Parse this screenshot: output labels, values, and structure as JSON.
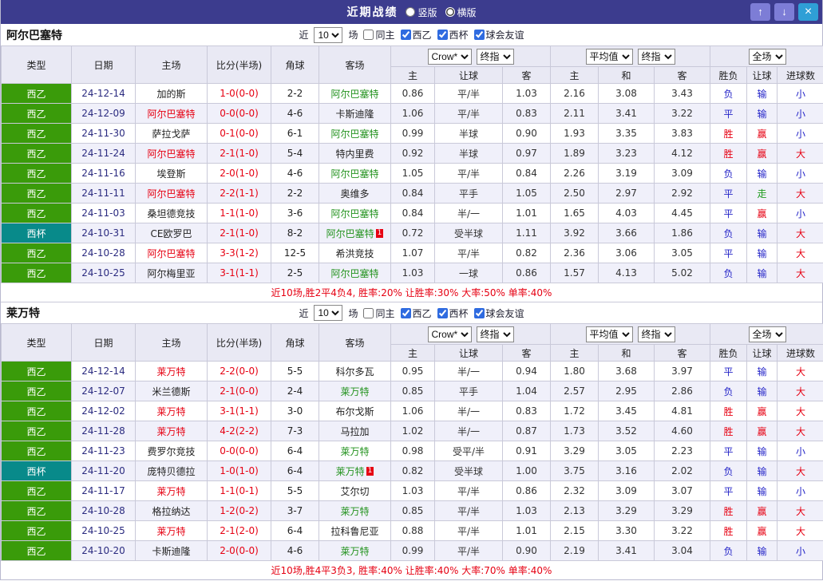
{
  "topbar": {
    "title": "近期战绩",
    "layout_options": [
      {
        "label": "竖版",
        "selected": false
      },
      {
        "label": "横版",
        "selected": true
      }
    ],
    "up_button": "↑",
    "down_button": "↓",
    "close_button": "×"
  },
  "filter": {
    "prefix": "近",
    "count": "10",
    "suffix": "场",
    "checkboxes": [
      {
        "key": "same-home",
        "label": "同主",
        "checked": false
      },
      {
        "key": "liga2",
        "label": "西乙",
        "checked": true
      },
      {
        "key": "cup",
        "label": "西杯",
        "checked": true
      },
      {
        "key": "friendly",
        "label": "球会友谊",
        "checked": true
      }
    ]
  },
  "table_head": {
    "left": [
      "类型",
      "日期",
      "主场",
      "比分(半场)",
      "角球",
      "客场"
    ],
    "group1": {
      "selects": [
        "Crow*",
        "终指"
      ],
      "cols": [
        "主",
        "让球",
        "客"
      ]
    },
    "group2": {
      "selects": [
        "平均值",
        "终指"
      ],
      "cols": [
        "主",
        "和",
        "客"
      ]
    },
    "group3": {
      "selects": [
        "全场"
      ],
      "cols": [
        "胜负",
        "让球",
        "进球数"
      ]
    }
  },
  "palette": {
    "topbar_bg": "#3c3c8e",
    "liga_green": "#3a9b0a",
    "cup_teal": "#088a8a",
    "win_red": "#e60012",
    "lose_blue": "#2424c8",
    "push_green": "#1e9b1e",
    "focus_away_green": "#22921d",
    "date_navy": "#2b2b80",
    "alt_row_bg": "#f0f0fa",
    "header_bg": "#e9e9f4"
  },
  "sections": [
    {
      "team": "阿尔巴塞特",
      "rows": [
        {
          "type": "西乙",
          "type_cls": "liga",
          "date": "24-12-14",
          "home": "加的斯",
          "home_cls": "plain",
          "score": "1-0(0-0)",
          "corner": "2-2",
          "away": "阿尔巴塞特",
          "away_cls": "focus-away",
          "odds": [
            "0.86",
            "平/半",
            "1.03",
            "2.16",
            "3.08",
            "3.43"
          ],
          "result": "负",
          "result_cls": "blue",
          "let": "输",
          "let_cls": "blue",
          "goal": "小",
          "goal_cls": "blue"
        },
        {
          "type": "西乙",
          "type_cls": "liga",
          "date": "24-12-09",
          "home": "阿尔巴塞特",
          "home_cls": "focus-home",
          "score": "0-0(0-0)",
          "corner": "4-6",
          "away": "卡斯迪隆",
          "away_cls": "plain",
          "odds": [
            "1.06",
            "平/半",
            "0.83",
            "2.11",
            "3.41",
            "3.22"
          ],
          "result": "平",
          "result_cls": "blue",
          "let": "输",
          "let_cls": "blue",
          "goal": "小",
          "goal_cls": "blue"
        },
        {
          "type": "西乙",
          "type_cls": "liga",
          "date": "24-11-30",
          "home": "萨拉戈萨",
          "home_cls": "plain",
          "score": "0-1(0-0)",
          "corner": "6-1",
          "away": "阿尔巴塞特",
          "away_cls": "focus-away",
          "odds": [
            "0.99",
            "半球",
            "0.90",
            "1.93",
            "3.35",
            "3.83"
          ],
          "result": "胜",
          "result_cls": "red",
          "let": "赢",
          "let_cls": "red",
          "goal": "小",
          "goal_cls": "blue"
        },
        {
          "type": "西乙",
          "type_cls": "liga",
          "date": "24-11-24",
          "home": "阿尔巴塞特",
          "home_cls": "focus-home",
          "score": "2-1(1-0)",
          "corner": "5-4",
          "away": "特内里费",
          "away_cls": "plain",
          "odds": [
            "0.92",
            "半球",
            "0.97",
            "1.89",
            "3.23",
            "4.12"
          ],
          "result": "胜",
          "result_cls": "red",
          "let": "赢",
          "let_cls": "red",
          "goal": "大",
          "goal_cls": "red"
        },
        {
          "type": "西乙",
          "type_cls": "liga",
          "date": "24-11-16",
          "home": "埃登斯",
          "home_cls": "plain",
          "score": "2-0(1-0)",
          "corner": "4-6",
          "away": "阿尔巴塞特",
          "away_cls": "focus-away",
          "odds": [
            "1.05",
            "平/半",
            "0.84",
            "2.26",
            "3.19",
            "3.09"
          ],
          "result": "负",
          "result_cls": "blue",
          "let": "输",
          "let_cls": "blue",
          "goal": "小",
          "goal_cls": "blue"
        },
        {
          "type": "西乙",
          "type_cls": "liga",
          "date": "24-11-11",
          "home": "阿尔巴塞特",
          "home_cls": "focus-home",
          "score": "2-2(1-1)",
          "corner": "2-2",
          "away": "奥维多",
          "away_cls": "plain",
          "odds": [
            "0.84",
            "平手",
            "1.05",
            "2.50",
            "2.97",
            "2.92"
          ],
          "result": "平",
          "result_cls": "blue",
          "let": "走",
          "let_cls": "green",
          "goal": "大",
          "goal_cls": "red"
        },
        {
          "type": "西乙",
          "type_cls": "liga",
          "date": "24-11-03",
          "home": "桑坦德竞技",
          "home_cls": "plain",
          "score": "1-1(1-0)",
          "corner": "3-6",
          "away": "阿尔巴塞特",
          "away_cls": "focus-away",
          "odds": [
            "0.84",
            "半/一",
            "1.01",
            "1.65",
            "4.03",
            "4.45"
          ],
          "result": "平",
          "result_cls": "blue",
          "let": "赢",
          "let_cls": "red",
          "goal": "小",
          "goal_cls": "blue"
        },
        {
          "type": "西杯",
          "type_cls": "cup",
          "date": "24-10-31",
          "home": "CE欧罗巴",
          "home_cls": "plain",
          "score": "2-1(1-0)",
          "corner": "8-2",
          "away": "阿尔巴塞特",
          "away_cls": "focus-away",
          "away_badge": "1",
          "odds": [
            "0.72",
            "受半球",
            "1.11",
            "3.92",
            "3.66",
            "1.86"
          ],
          "result": "负",
          "result_cls": "blue",
          "let": "输",
          "let_cls": "blue",
          "goal": "大",
          "goal_cls": "red"
        },
        {
          "type": "西乙",
          "type_cls": "liga",
          "date": "24-10-28",
          "home": "阿尔巴塞特",
          "home_cls": "focus-home",
          "score": "3-3(1-2)",
          "corner": "12-5",
          "away": "希洪竞技",
          "away_cls": "plain",
          "odds": [
            "1.07",
            "平/半",
            "0.82",
            "2.36",
            "3.06",
            "3.05"
          ],
          "result": "平",
          "result_cls": "blue",
          "let": "输",
          "let_cls": "blue",
          "goal": "大",
          "goal_cls": "red"
        },
        {
          "type": "西乙",
          "type_cls": "liga",
          "date": "24-10-25",
          "home": "阿尔梅里亚",
          "home_cls": "plain",
          "score": "3-1(1-1)",
          "corner": "2-5",
          "away": "阿尔巴塞特",
          "away_cls": "focus-away",
          "odds": [
            "1.03",
            "一球",
            "0.86",
            "1.57",
            "4.13",
            "5.02"
          ],
          "result": "负",
          "result_cls": "blue",
          "let": "输",
          "let_cls": "blue",
          "goal": "大",
          "goal_cls": "red"
        }
      ],
      "summary": "近10场,胜2平4负4, 胜率:20% 让胜率:30% 大率:50% 单率:40%"
    },
    {
      "team": "莱万特",
      "rows": [
        {
          "type": "西乙",
          "type_cls": "liga",
          "date": "24-12-14",
          "home": "莱万特",
          "home_cls": "focus-home",
          "score": "2-2(0-0)",
          "corner": "5-5",
          "away": "科尔多瓦",
          "away_cls": "plain",
          "odds": [
            "0.95",
            "半/一",
            "0.94",
            "1.80",
            "3.68",
            "3.97"
          ],
          "result": "平",
          "result_cls": "blue",
          "let": "输",
          "let_cls": "blue",
          "goal": "大",
          "goal_cls": "red"
        },
        {
          "type": "西乙",
          "type_cls": "liga",
          "date": "24-12-07",
          "home": "米兰德斯",
          "home_cls": "plain",
          "score": "2-1(0-0)",
          "corner": "2-4",
          "away": "莱万特",
          "away_cls": "focus-away",
          "odds": [
            "0.85",
            "平手",
            "1.04",
            "2.57",
            "2.95",
            "2.86"
          ],
          "result": "负",
          "result_cls": "blue",
          "let": "输",
          "let_cls": "blue",
          "goal": "大",
          "goal_cls": "red"
        },
        {
          "type": "西乙",
          "type_cls": "liga",
          "date": "24-12-02",
          "home": "莱万特",
          "home_cls": "focus-home",
          "score": "3-1(1-1)",
          "corner": "3-0",
          "away": "布尔戈斯",
          "away_cls": "plain",
          "odds": [
            "1.06",
            "半/一",
            "0.83",
            "1.72",
            "3.45",
            "4.81"
          ],
          "result": "胜",
          "result_cls": "red",
          "let": "赢",
          "let_cls": "red",
          "goal": "大",
          "goal_cls": "red"
        },
        {
          "type": "西乙",
          "type_cls": "liga",
          "date": "24-11-28",
          "home": "莱万特",
          "home_cls": "focus-home",
          "score": "4-2(2-2)",
          "corner": "7-3",
          "away": "马拉加",
          "away_cls": "plain",
          "odds": [
            "1.02",
            "半/一",
            "0.87",
            "1.73",
            "3.52",
            "4.60"
          ],
          "result": "胜",
          "result_cls": "red",
          "let": "赢",
          "let_cls": "red",
          "goal": "大",
          "goal_cls": "red"
        },
        {
          "type": "西乙",
          "type_cls": "liga",
          "date": "24-11-23",
          "home": "费罗尔竞技",
          "home_cls": "plain",
          "score": "0-0(0-0)",
          "corner": "6-4",
          "away": "莱万特",
          "away_cls": "focus-away",
          "odds": [
            "0.98",
            "受平/半",
            "0.91",
            "3.29",
            "3.05",
            "2.23"
          ],
          "result": "平",
          "result_cls": "blue",
          "let": "输",
          "let_cls": "blue",
          "goal": "小",
          "goal_cls": "blue"
        },
        {
          "type": "西杯",
          "type_cls": "cup",
          "date": "24-11-20",
          "home": "庞特贝德拉",
          "home_cls": "plain",
          "score": "1-0(1-0)",
          "corner": "6-4",
          "away": "莱万特",
          "away_cls": "focus-away",
          "away_badge": "1",
          "odds": [
            "0.82",
            "受半球",
            "1.00",
            "3.75",
            "3.16",
            "2.02"
          ],
          "result": "负",
          "result_cls": "blue",
          "let": "输",
          "let_cls": "blue",
          "goal": "大",
          "goal_cls": "red"
        },
        {
          "type": "西乙",
          "type_cls": "liga",
          "date": "24-11-17",
          "home": "莱万特",
          "home_cls": "focus-home",
          "score": "1-1(0-1)",
          "corner": "5-5",
          "away": "艾尔切",
          "away_cls": "plain",
          "odds": [
            "1.03",
            "平/半",
            "0.86",
            "2.32",
            "3.09",
            "3.07"
          ],
          "result": "平",
          "result_cls": "blue",
          "let": "输",
          "let_cls": "blue",
          "goal": "小",
          "goal_cls": "blue"
        },
        {
          "type": "西乙",
          "type_cls": "liga",
          "date": "24-10-28",
          "home": "格拉纳达",
          "home_cls": "plain",
          "score": "1-2(0-2)",
          "corner": "3-7",
          "away": "莱万特",
          "away_cls": "focus-away",
          "odds": [
            "0.85",
            "平/半",
            "1.03",
            "2.13",
            "3.29",
            "3.29"
          ],
          "result": "胜",
          "result_cls": "red",
          "let": "赢",
          "let_cls": "red",
          "goal": "大",
          "goal_cls": "red"
        },
        {
          "type": "西乙",
          "type_cls": "liga",
          "date": "24-10-25",
          "home": "莱万特",
          "home_cls": "focus-home",
          "score": "2-1(2-0)",
          "corner": "6-4",
          "away": "拉科鲁尼亚",
          "away_cls": "plain",
          "odds": [
            "0.88",
            "平/半",
            "1.01",
            "2.15",
            "3.30",
            "3.22"
          ],
          "result": "胜",
          "result_cls": "red",
          "let": "赢",
          "let_cls": "red",
          "goal": "大",
          "goal_cls": "red"
        },
        {
          "type": "西乙",
          "type_cls": "liga",
          "date": "24-10-20",
          "home": "卡斯迪隆",
          "home_cls": "plain",
          "score": "2-0(0-0)",
          "corner": "4-6",
          "away": "莱万特",
          "away_cls": "focus-away",
          "odds": [
            "0.99",
            "平/半",
            "0.90",
            "2.19",
            "3.41",
            "3.04"
          ],
          "result": "负",
          "result_cls": "blue",
          "let": "输",
          "let_cls": "blue",
          "goal": "小",
          "goal_cls": "blue"
        }
      ],
      "summary": "近10场,胜4平3负3, 胜率:40% 让胜率:40% 大率:70% 单率:40%"
    }
  ]
}
